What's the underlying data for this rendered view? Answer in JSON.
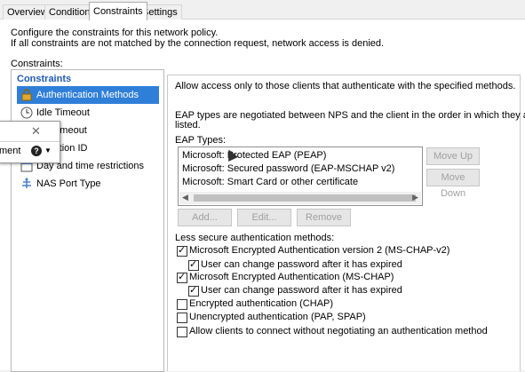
{
  "tabs": [
    "Overview",
    "Conditions",
    "Constraints",
    "Settings"
  ],
  "active_tab": "Constraints",
  "intro_line1": "Configure the constraints for this network policy.",
  "intro_line2": "If all constraints are not matched by the connection request, network access is denied.",
  "constraints_label": "Constraints:",
  "tree": {
    "header": "Constraints",
    "items": [
      {
        "label": "Authentication Methods",
        "icon": "lock-icon",
        "selected": true
      },
      {
        "label": "Idle Timeout",
        "icon": "clock-icon",
        "selected": false
      },
      {
        "label": "ion Timeout",
        "icon": "clock-icon",
        "selected": false
      },
      {
        "label": "d Station ID",
        "icon": "phone-icon",
        "selected": false
      },
      {
        "label": "Day and time restrictions",
        "icon": "calendar-icon",
        "selected": false
      },
      {
        "label": "NAS Port Type",
        "icon": "network-icon",
        "selected": false
      }
    ]
  },
  "popup": {
    "text": "ment",
    "close": "✕"
  },
  "right": {
    "description": "Allow access only to those clients that authenticate with the specified methods.",
    "eap_note_line1": "EAP types are negotiated between NPS and the client in the order in which they are",
    "eap_note_line2": "listed.",
    "eap_types_label": "EAP Types:",
    "eap_types": [
      "Microsoft: Protected EAP (PEAP)",
      "Microsoft: Secured password (EAP-MSCHAP v2)",
      "Microsoft: Smart Card or other certificate"
    ],
    "move_up": "Move Up",
    "move_down": "Move Down",
    "add": "Add...",
    "edit": "Edit...",
    "remove": "Remove",
    "less_secure_label": "Less secure authentication methods:",
    "methods": [
      {
        "label": "Microsoft Encrypted Authentication version 2 (MS-CHAP-v2)",
        "checked": true,
        "indent": false
      },
      {
        "label": "User can change password after it has expired",
        "checked": true,
        "indent": true
      },
      {
        "label": "Microsoft Encrypted Authentication (MS-CHAP)",
        "checked": true,
        "indent": false
      },
      {
        "label": "User can change password after it has expired",
        "checked": true,
        "indent": true
      },
      {
        "label": "Encrypted authentication (CHAP)",
        "checked": false,
        "indent": false
      },
      {
        "label": "Unencrypted authentication (PAP, SPAP)",
        "checked": false,
        "indent": false
      },
      {
        "label": "Allow clients to connect without negotiating an authentication method",
        "checked": false,
        "indent": false
      }
    ]
  },
  "colors": {
    "selection": "#2f7fd9",
    "tree_header": "#1f5ab1"
  }
}
